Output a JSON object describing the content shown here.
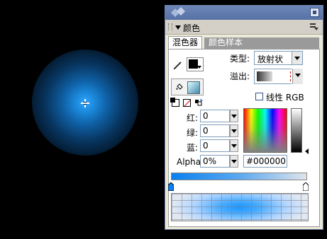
{
  "panel": {
    "title": "颜色",
    "tabs": [
      "混色器",
      "颜色样本"
    ]
  },
  "fields": {
    "type_label": "类型:",
    "type_value": "放射状",
    "overflow_label": "溢出:",
    "linear_rgb_label": "线性 RGB",
    "red_label": "红:",
    "red_value": "0",
    "green_label": "绿:",
    "green_value": "0",
    "blue_label": "蓝:",
    "blue_value": "0",
    "alpha_label": "Alpha:",
    "alpha_value": "0%",
    "hex_value": "#000000"
  },
  "colors": {
    "stroke": "#000000",
    "gradient_start": "#0b80f0",
    "gradient_end": "#e0e4ea",
    "canvas_glow": "#1a86d8"
  },
  "icons": [
    "pencil-icon",
    "paint-bucket-icon",
    "default-colors-icon",
    "no-color-icon",
    "swap-colors-icon",
    "panel-menu-icon"
  ]
}
